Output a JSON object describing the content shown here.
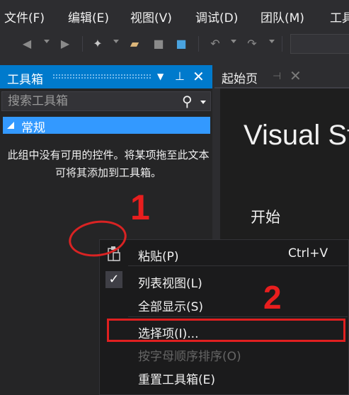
{
  "menubar": {
    "items": [
      "文件(F)",
      "编辑(E)",
      "视图(V)",
      "调试(D)",
      "团队(M)",
      "工具"
    ]
  },
  "toolbox": {
    "title": "工具箱",
    "search_placeholder": "搜索工具箱",
    "group_label": "常规",
    "empty_message": "此组中没有可用的控件。将某项拖至此文本可将其添加到工具箱。"
  },
  "document": {
    "tab_label": "起始页",
    "product_title": "Visual Studio",
    "start_label": "开始"
  },
  "context_menu": {
    "items": [
      {
        "label": "粘贴(P)",
        "shortcut": "Ctrl+V",
        "icon": "paste-icon",
        "enabled": true
      },
      {
        "label": "列表视图(L)",
        "checked": true,
        "enabled": true
      },
      {
        "label": "全部显示(S)",
        "enabled": true
      },
      {
        "label": "选择项(I)...",
        "enabled": true
      },
      {
        "label": "按字母顺序排序(O)",
        "enabled": false
      },
      {
        "label": "重置工具箱(E)",
        "enabled": true
      }
    ]
  },
  "annotations": {
    "step1": "1",
    "step2": "2",
    "color": "#e02020"
  },
  "colors": {
    "accent": "#007acc",
    "selected_group": "#3399ff",
    "background": "#2d2d30"
  }
}
